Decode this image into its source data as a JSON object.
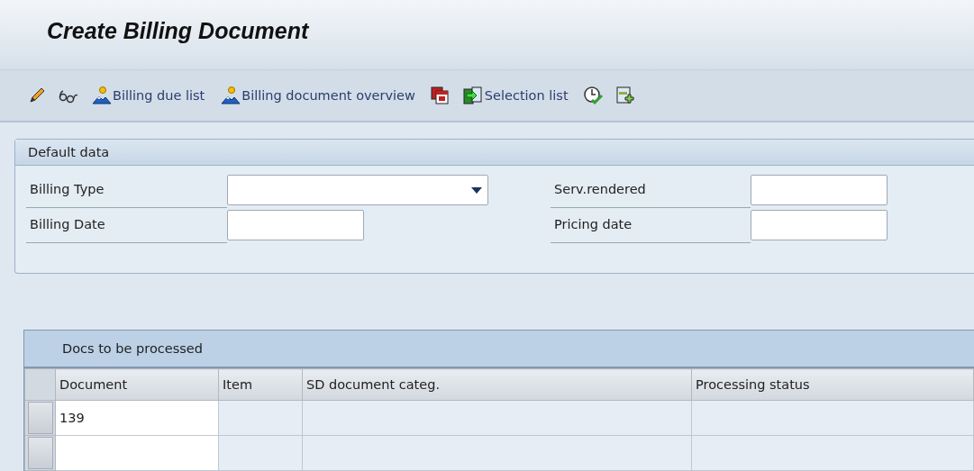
{
  "window": {
    "title": "Create Billing Document"
  },
  "toolbar": [
    {
      "kind": "icon"
    },
    {
      "kind": "icon"
    },
    {
      "kind": "button",
      "label": "Billing due list"
    },
    {
      "kind": "button",
      "label": "Billing document overview"
    },
    {
      "kind": "icon"
    },
    {
      "kind": "button",
      "label": "Selection list"
    },
    {
      "kind": "icon"
    },
    {
      "kind": "icon"
    }
  ],
  "default_data": {
    "title": "Default data",
    "rows": [
      [
        {
          "label": "Billing Type",
          "kind": "dropdown"
        },
        {
          "label": "Serv.rendered",
          "kind": "text"
        }
      ],
      [
        {
          "label": "Billing Date",
          "kind": "text"
        },
        {
          "label": "Pricing date",
          "kind": "text"
        }
      ]
    ]
  },
  "table": {
    "title": "Docs to be processed",
    "columns": [
      "Document",
      "Item",
      "SD document categ.",
      "Processing status"
    ],
    "rows": [
      [
        "139",
        "",
        "",
        ""
      ],
      [
        "",
        "",
        "",
        ""
      ]
    ]
  }
}
